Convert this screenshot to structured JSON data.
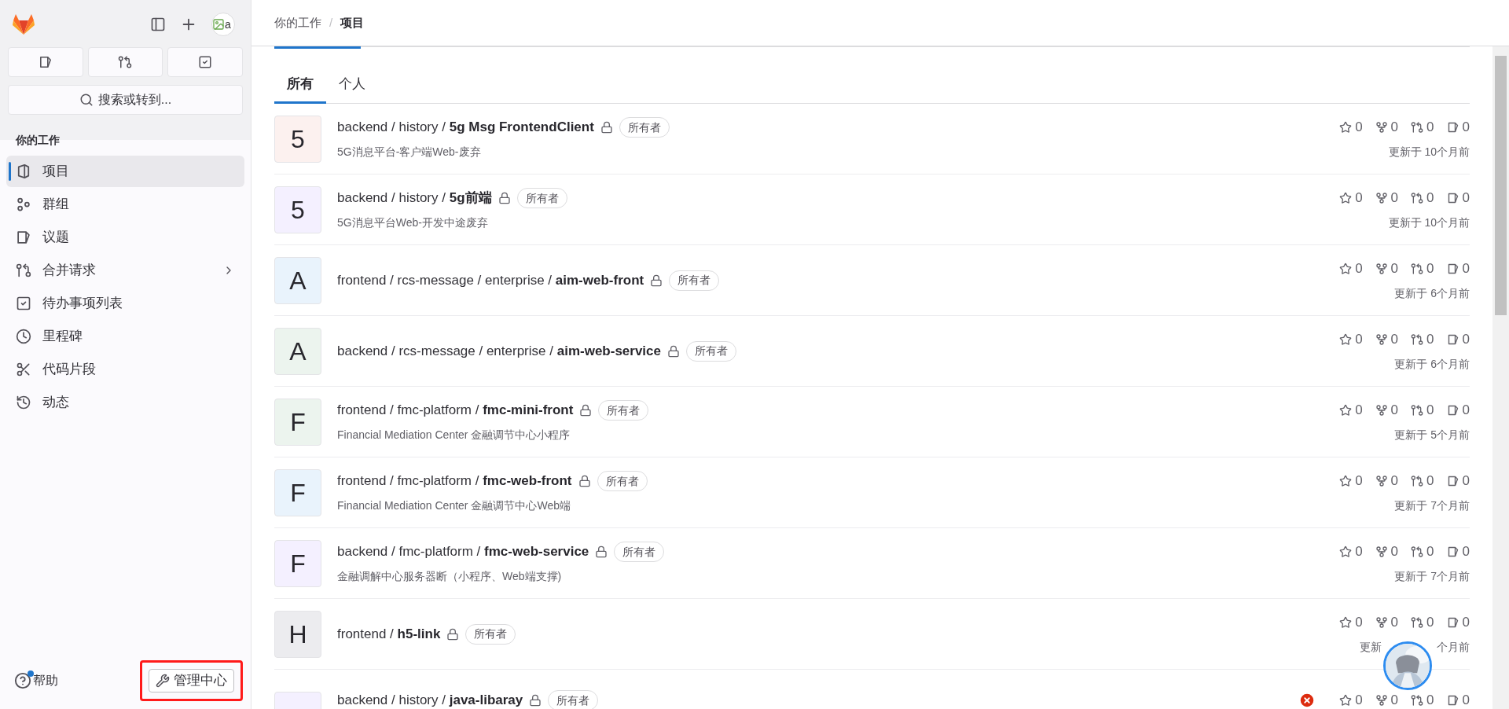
{
  "sidebar": {
    "avatar_alt": "a",
    "search": "搜索或转到...",
    "section_title": "你的工作",
    "items": [
      {
        "label": "项目",
        "selected": true,
        "expandable": false
      },
      {
        "label": "群组",
        "selected": false,
        "expandable": false
      },
      {
        "label": "议题",
        "selected": false,
        "expandable": false
      },
      {
        "label": "合并请求",
        "selected": false,
        "expandable": true
      },
      {
        "label": "待办事项列表",
        "selected": false,
        "expandable": false
      },
      {
        "label": "里程碑",
        "selected": false,
        "expandable": false
      },
      {
        "label": "代码片段",
        "selected": false,
        "expandable": false
      },
      {
        "label": "动态",
        "selected": false,
        "expandable": false
      }
    ],
    "help": "帮助",
    "help_notification": true,
    "admin_button": "管理中心",
    "admin_highlighted": true
  },
  "breadcrumb": [
    "你的工作",
    "项目"
  ],
  "breadcrumb_separator": "/",
  "tabs": [
    {
      "label": "所有",
      "selected": true
    },
    {
      "label": "个人",
      "selected": false
    }
  ],
  "projects": [
    {
      "letter": "5",
      "color": "#fcf1ef",
      "path": "backend / history /",
      "name": "5g Msg FrontendClient",
      "private": true,
      "role": "所有者",
      "description": "5G消息平台-客户端Web-废弃",
      "star_count": "0",
      "forks": "0",
      "merge_requests": "0",
      "issues": "0",
      "updated": [
        "更新于 10个月前"
      ],
      "pipeline_failed": false
    },
    {
      "letter": "5",
      "color": "#f4f0ff",
      "path": "backend / history /",
      "name": "5g前端",
      "private": true,
      "role": "所有者",
      "description": "5G消息平台Web-开发中途废弃",
      "star_count": "0",
      "forks": "0",
      "merge_requests": "0",
      "issues": "0",
      "updated": [
        "更新于 10个月前"
      ],
      "pipeline_failed": false
    },
    {
      "letter": "A",
      "color": "#e9f3fc",
      "path": "frontend / rcs-message / enterprise /",
      "name": "aim-web-front",
      "private": true,
      "role": "所有者",
      "star_count": "0",
      "forks": "0",
      "merge_requests": "0",
      "issues": "0",
      "updated": [
        "更新于 6个月前"
      ],
      "pipeline_failed": false
    },
    {
      "letter": "A",
      "color": "#ecf4ee",
      "path": "backend / rcs-message / enterprise /",
      "name": "aim-web-service",
      "private": true,
      "role": "所有者",
      "star_count": "0",
      "forks": "0",
      "merge_requests": "0",
      "issues": "0",
      "updated": [
        "更新于 6个月前"
      ],
      "pipeline_failed": false
    },
    {
      "letter": "F",
      "color": "#ecf4ee",
      "path": "frontend / fmc-platform /",
      "name": "fmc-mini-front",
      "private": true,
      "role": "所有者",
      "description": "Financial Mediation Center 金融调节中心小程序",
      "star_count": "0",
      "forks": "0",
      "merge_requests": "0",
      "issues": "0",
      "updated": [
        "更新于 5个月前"
      ],
      "pipeline_failed": false
    },
    {
      "letter": "F",
      "color": "#e9f3fc",
      "path": "frontend / fmc-platform /",
      "name": "fmc-web-front",
      "private": true,
      "role": "所有者",
      "description": "Financial Mediation Center 金融调节中心Web端",
      "star_count": "0",
      "forks": "0",
      "merge_requests": "0",
      "issues": "0",
      "updated": [
        "更新于 7个月前"
      ],
      "pipeline_failed": false
    },
    {
      "letter": "F",
      "color": "#f4f0ff",
      "path": "backend / fmc-platform /",
      "name": "fmc-web-service",
      "private": true,
      "role": "所有者",
      "description": "金融调解中心服务器断（小程序、Web端支撑)",
      "star_count": "0",
      "forks": "0",
      "merge_requests": "0",
      "issues": "0",
      "updated": [
        "更新于 7个月前"
      ],
      "pipeline_failed": false
    },
    {
      "letter": "H",
      "color": "#ececef",
      "path": "frontend /",
      "name": "h5-link",
      "private": true,
      "role": "所有者",
      "star_count": "0",
      "forks": "0",
      "merge_requests": "0",
      "issues": "0",
      "updated": [
        "更新",
        "个月前"
      ],
      "pipeline_failed": false
    },
    {
      "color": "#f4f0ff",
      "path": "backend / history /",
      "name": "java-libaray",
      "private": true,
      "role": "所有者",
      "star_count": "0",
      "forks": "0",
      "merge_requests": "0",
      "issues": "0",
      "pipeline_failed": true
    }
  ]
}
